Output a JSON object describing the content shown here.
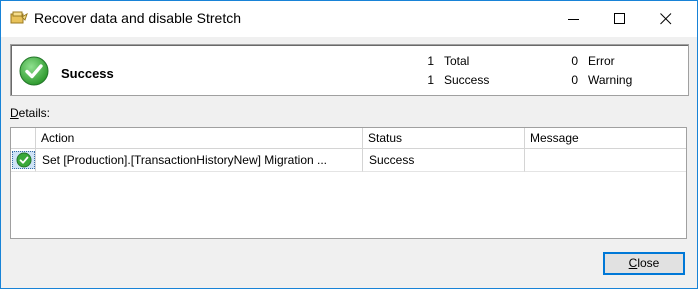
{
  "window": {
    "title": "Recover data and disable Stretch"
  },
  "summary": {
    "status": "Success",
    "stats": [
      {
        "count": "1",
        "label": "Total"
      },
      {
        "count": "1",
        "label": "Success"
      },
      {
        "count": "0",
        "label": "Error"
      },
      {
        "count": "0",
        "label": "Warning"
      }
    ]
  },
  "details": {
    "label_first": "D",
    "label_rest": "etails:",
    "columns": [
      "Action",
      "Status",
      "Message"
    ],
    "rows": [
      {
        "action": "Set [Production].[TransactionHistoryNew] Migration ...",
        "status": "Success",
        "message": ""
      }
    ]
  },
  "buttons": {
    "close_first": "C",
    "close_rest": "lose"
  },
  "colors": {
    "accent": "#0078d7",
    "success_green": "#3aa83a"
  },
  "icons": [
    "wizard-icon",
    "minimize-icon",
    "maximize-icon",
    "close-icon",
    "success-check-icon",
    "row-success-icon"
  ]
}
